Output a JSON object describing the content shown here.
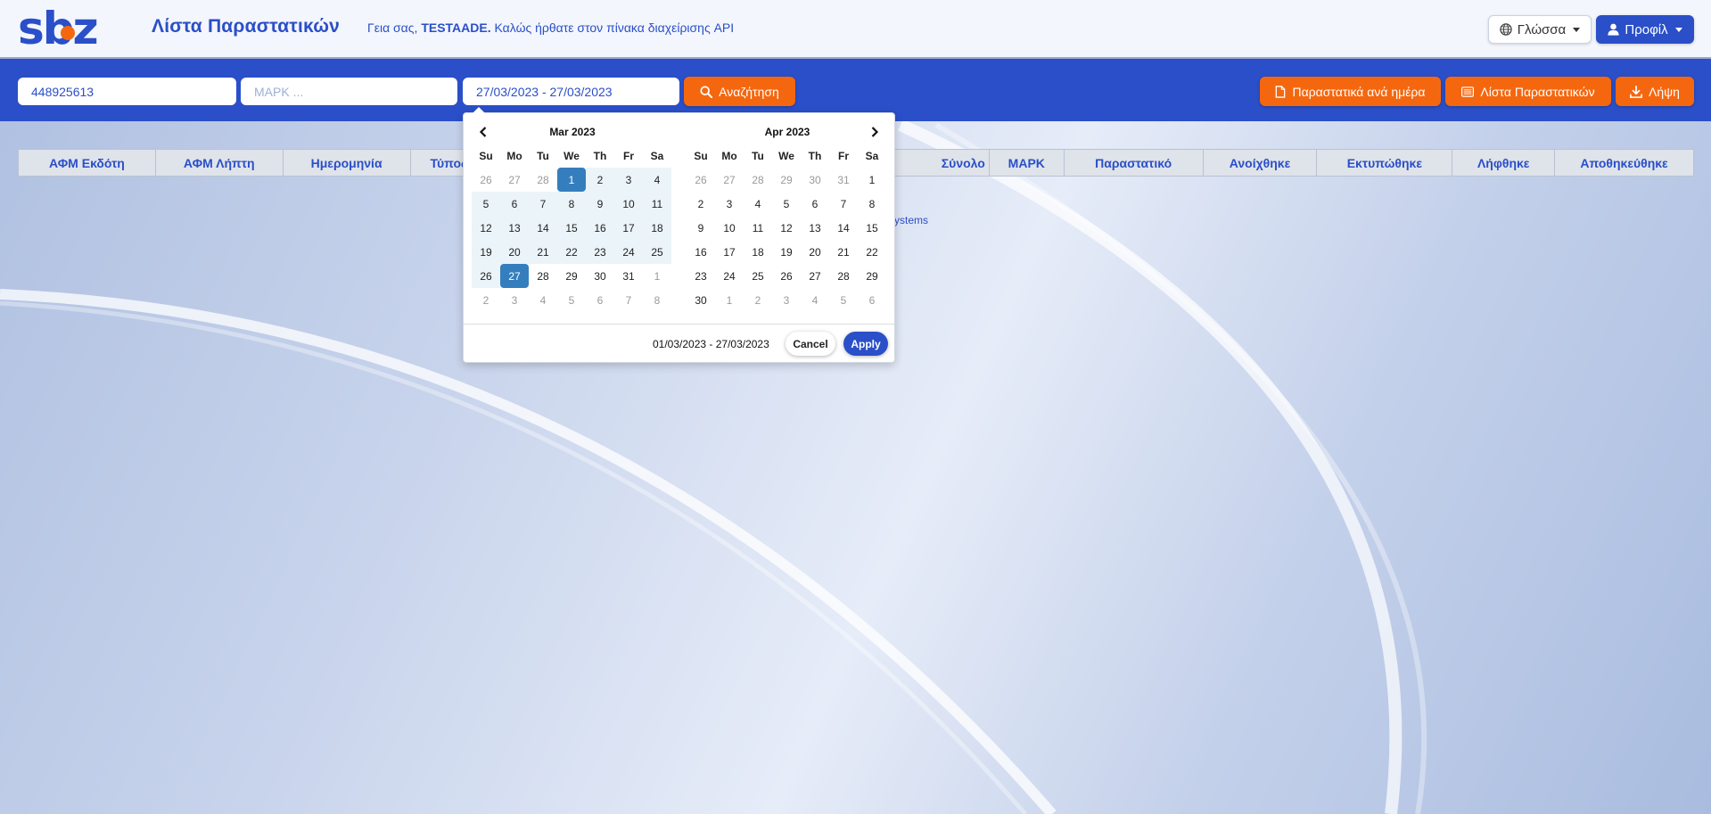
{
  "header": {
    "logo_text": "sbz",
    "title": "Λίστα Παραστατικών",
    "greeting_prefix": "Γεια σας,",
    "greeting_user": "TESTAADE.",
    "greeting_suffix": "Καλώς ήρθατε στον πίνακα διαχείρισης API",
    "language_label": "Γλώσσα",
    "profile_label": "Προφίλ"
  },
  "toolbar": {
    "vat_value": "448925613",
    "mark_placeholder": "ΜΑΡΚ ...",
    "date_range_value": "27/03/2023 - 27/03/2023",
    "search_label": "Αναζήτηση",
    "per_day_label": "Παραστατικά ανά ημέρα",
    "list_label": "Λίστα Παραστατικών",
    "download_label": "Λήψη"
  },
  "table": {
    "columns": [
      "ΑΦΜ Εκδότη",
      "ΑΦΜ Λήπτη",
      "Ημερομηνία",
      "Τύπος",
      "Σύνολο",
      "ΜΑΡΚ",
      "Παραστατικό",
      "Ανοίχθηκε",
      "Εκτυπώθηκε",
      "Λήφθηκε",
      "Αποθηκεύθηκε"
    ]
  },
  "footer_fragment": "ystems",
  "datepicker": {
    "weekdays": [
      "Su",
      "Mo",
      "Tu",
      "We",
      "Th",
      "Fr",
      "Sa"
    ],
    "left_month": "Mar 2023",
    "right_month": "Apr 2023",
    "left_weeks": [
      [
        "26",
        "27",
        "28",
        "1",
        "2",
        "3",
        "4"
      ],
      [
        "5",
        "6",
        "7",
        "8",
        "9",
        "10",
        "11"
      ],
      [
        "12",
        "13",
        "14",
        "15",
        "16",
        "17",
        "18"
      ],
      [
        "19",
        "20",
        "21",
        "22",
        "23",
        "24",
        "25"
      ],
      [
        "26",
        "27",
        "28",
        "29",
        "30",
        "31",
        "1"
      ],
      [
        "2",
        "3",
        "4",
        "5",
        "6",
        "7",
        "8"
      ]
    ],
    "right_weeks": [
      [
        "26",
        "27",
        "28",
        "29",
        "30",
        "31",
        "1"
      ],
      [
        "2",
        "3",
        "4",
        "5",
        "6",
        "7",
        "8"
      ],
      [
        "9",
        "10",
        "11",
        "12",
        "13",
        "14",
        "15"
      ],
      [
        "16",
        "17",
        "18",
        "19",
        "20",
        "21",
        "22"
      ],
      [
        "23",
        "24",
        "25",
        "26",
        "27",
        "28",
        "29"
      ],
      [
        "30",
        "1",
        "2",
        "3",
        "4",
        "5",
        "6"
      ]
    ],
    "selected_range": "01/03/2023 - 27/03/2023",
    "cancel_label": "Cancel",
    "apply_label": "Apply"
  },
  "colors": {
    "primary": "#2a4fc8",
    "accent": "#f5670f",
    "selected_day": "#357ebd",
    "range_bg": "#ebf4f8"
  }
}
